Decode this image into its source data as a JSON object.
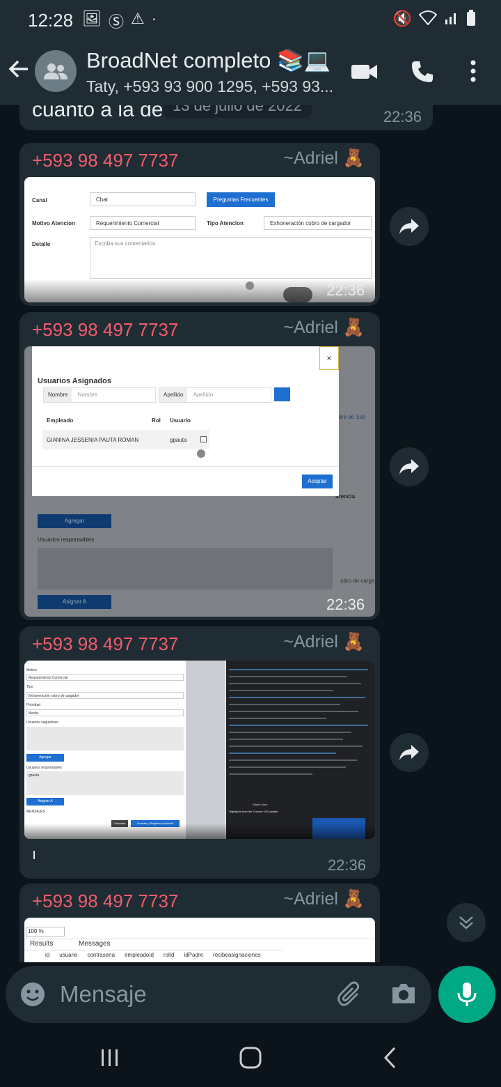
{
  "status_bar": {
    "time": "12:28",
    "left_icons": [
      "image-icon",
      "s-app-icon",
      "alert-icon",
      "dot-icon"
    ],
    "right_icons": [
      "mute-icon",
      "wifi-icon",
      "signal-icon",
      "battery-icon"
    ]
  },
  "header": {
    "title": "BroadNet completo 📚💻",
    "subtitle": "Taty, +593 93 900 1295, +593 93..."
  },
  "chat": {
    "top_partial": {
      "text": "cuanto a la de",
      "date_chip": "13 de julio de 2022",
      "time": "22:36"
    },
    "messages": [
      {
        "sender": "+593 98 497 7737",
        "alias": "~Adriel 🧸",
        "time": "22:36",
        "image": {
          "canal_label": "Canal",
          "canal_value": "Chat",
          "faq_button": "Preguntas Frecuentes",
          "motivo_label": "Motivo Atencion",
          "motivo_value": "Requerimiento Comercial",
          "tipo_label": "Tipo Atencion",
          "tipo_value": "Exhoneración cobro de cargador",
          "detalle_label": "Detalle",
          "detalle_placeholder": "Escriba sus comentarios"
        }
      },
      {
        "sender": "+593 98 497 7737",
        "alias": "~Adriel 🧸",
        "time": "22:36",
        "image": {
          "modal_title": "Usuarios Asignados",
          "nombre_label": "Nombre",
          "nombre_placeholder": "Nombre",
          "apellido_label": "Apellido",
          "apellido_placeholder": "Apellido",
          "col_empleado": "Empleado",
          "col_rol": "Rol",
          "col_usuario": "Usuario",
          "row_empleado": "GIANINA JESSENIA PAUTA ROMAN",
          "row_usuario": "gpauta",
          "aceptar": "Aceptar",
          "close": "×",
          "bg_agregar": "Agregar",
          "bg_responsables": "Usuarios responsables",
          "bg_asignar": "Asignar A",
          "bg_right_1": "adre de Sati",
          "bg_right_2": "arencia",
          "bg_right_3": "obro de carga"
        }
      },
      {
        "sender": "+593 98 497 7737",
        "alias": "~Adriel 🧸",
        "time": "22:36",
        "caption": "ı",
        "image": {
          "motivo": "Motivo",
          "motivo_value": "Requerimiento Comercial",
          "tipo": "Tipo",
          "tipo_value": "Exhoneración cobro de cargador",
          "prioridad": "Prioridad",
          "prioridad_value": "Media",
          "seguidores": "Usuarios seguidores",
          "agregar": "Agregar",
          "responsables": "Usuarios responsables",
          "responsable_value": "gpauta",
          "asignar": "Asignar A",
          "mensajes": "MENSAJES",
          "cancelar": "Cancelar",
          "guardar": "Guardar y Registrar Actividad",
          "devtools_tab": "What's New",
          "devtools_heading": "Highlights from the Chrome 103 update"
        }
      },
      {
        "sender": "+593 98 497 7737",
        "alias": "~Adriel 🧸",
        "image": {
          "zoom": "100 %",
          "tab_results": "Results",
          "tab_messages": "Messages",
          "columns": [
            "id",
            "usuario",
            "contrasena",
            "empleadoId",
            "rolId",
            "idPadre",
            "recibeasignaciones"
          ]
        }
      }
    ]
  },
  "input": {
    "placeholder": "Mensaje"
  },
  "colors": {
    "background": "#0b141a",
    "bar": "#1f2c33",
    "sender": "#f15c6d",
    "accent": "#00a884",
    "link_blue": "#1e6fd0"
  }
}
